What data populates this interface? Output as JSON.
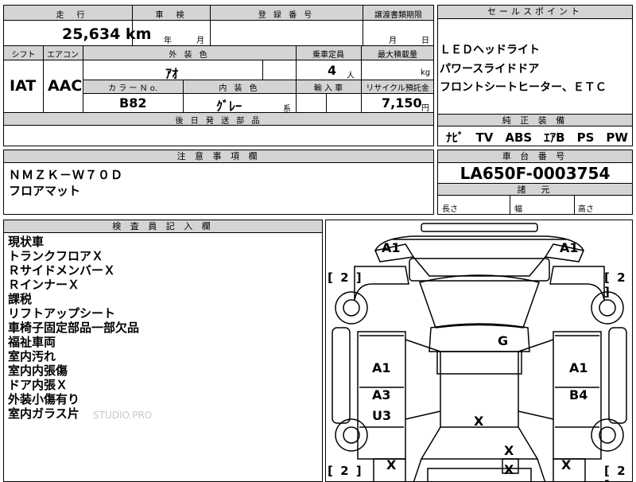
{
  "header": {
    "mileage_label": "走　行",
    "inspection_label": "車　検",
    "registration_label": "登 録 番 号",
    "transfer_label": "譲渡書類期限",
    "mileage_value": "25,634 km",
    "inspection_year": "年",
    "inspection_month": "月",
    "transfer_month": "月",
    "transfer_day": "日"
  },
  "specs": {
    "shift_label": "シフト",
    "ac_label": "エアコン",
    "exterior_color_label": "外 装 色",
    "capacity_label": "乗車定員",
    "max_load_label": "最大積載量",
    "shift_value": "IAT",
    "ac_value": "AAC",
    "exterior_color_value": "ｱｵ",
    "capacity_value": "4",
    "capacity_unit": "人",
    "load_unit": "kg",
    "color_no_label": "カ ラ ー Ｎ o.",
    "interior_color_label": "内 装 色",
    "import_label": "輸 入 車",
    "recycle_label": "リサイクル預託金",
    "color_no_value": "B82",
    "interior_color_value": "ｸﾞﾚｰ",
    "interior_suffix": "系",
    "recycle_value": "7,150",
    "recycle_unit": "円",
    "shipping_label": "後 日 発 送 部 品"
  },
  "sales_points": {
    "label": "セールスポイント",
    "items": [
      "ＬＥＤヘッドライト",
      "パワースライドドア",
      "フロントシートヒーター、ＥＴＣ"
    ]
  },
  "equipment": {
    "label": "純 正 装 備",
    "value": "ﾅﾋﾞ　TV　ABS　ｴｱB　PS　PW"
  },
  "notes": {
    "label": "注 意 事 項 欄",
    "lines": [
      "ＮＭＺＫ－Ｗ７０Ｄ",
      "フロアマット"
    ]
  },
  "chassis": {
    "label": "車 台 番 号",
    "value": "LA650F-0003754",
    "dimensions_label": "諸　元",
    "length_label": "長さ",
    "width_label": "幅",
    "height_label": "高さ"
  },
  "inspector": {
    "label": "検 査 員 記 入 欄",
    "lines": [
      "現状車",
      "トランクフロアＸ",
      "ＲサイドメンバーＸ",
      "ＲインナーＸ",
      "課税",
      "リフトアップシート",
      "車椅子固定部品一部欠品",
      "福祉車両",
      "室内汚れ",
      "室内内張傷",
      "ドア内張Ｘ",
      "外装小傷有り",
      "室内ガラス片"
    ],
    "watermark": "STUDIO.PRO"
  },
  "diagram": {
    "marks": {
      "front_left": "A1",
      "front_right": "A1",
      "tire_fl": "[ 2 ]",
      "tire_fr": "[ 2 ]",
      "tire_rl": "[ 2 ]",
      "tire_rr": "[ 2 ]",
      "roof": "G",
      "left_front_door": "A1",
      "right_front_door": "A1",
      "left_rear_a": "A3",
      "left_rear_u": "U3",
      "right_rear": "B4",
      "floor": "X",
      "rear_center": "X",
      "rear_left": "X",
      "rear_right": "X",
      "trunk": "X"
    }
  }
}
